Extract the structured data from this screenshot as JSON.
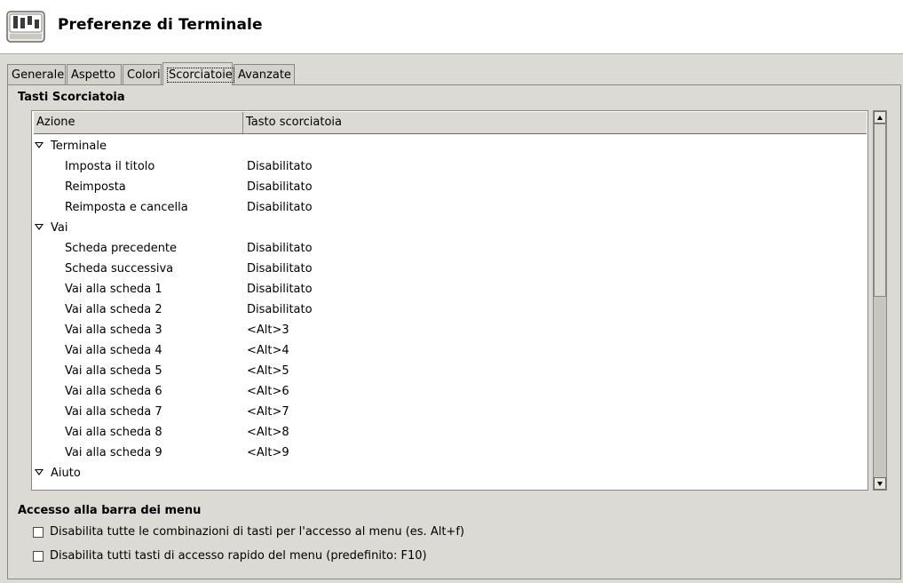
{
  "window": {
    "title": "Preferenze di Terminale"
  },
  "tabs": [
    {
      "label": "Generale",
      "active": false
    },
    {
      "label": "Aspetto",
      "active": false
    },
    {
      "label": "Colori",
      "active": false
    },
    {
      "label": "Scorciatoie",
      "active": true
    },
    {
      "label": "Avanzate",
      "active": false
    }
  ],
  "shortcuts": {
    "section_title": "Tasti Scorciatoia",
    "columns": {
      "action": "Azione",
      "shortcut": "Tasto scorciatoia"
    },
    "rows": [
      {
        "group": "Terminale"
      },
      {
        "action": "Imposta il titolo",
        "shortcut": "Disabilitato"
      },
      {
        "action": "Reimposta",
        "shortcut": "Disabilitato"
      },
      {
        "action": "Reimposta e cancella",
        "shortcut": "Disabilitato"
      },
      {
        "group": "Vai"
      },
      {
        "action": "Scheda precedente",
        "shortcut": "Disabilitato"
      },
      {
        "action": "Scheda successiva",
        "shortcut": "Disabilitato"
      },
      {
        "action": "Vai alla scheda 1",
        "shortcut": "Disabilitato"
      },
      {
        "action": "Vai alla scheda 2",
        "shortcut": "Disabilitato"
      },
      {
        "action": "Vai alla scheda 3",
        "shortcut": "<Alt>3"
      },
      {
        "action": "Vai alla scheda 4",
        "shortcut": "<Alt>4"
      },
      {
        "action": "Vai alla scheda 5",
        "shortcut": "<Alt>5"
      },
      {
        "action": "Vai alla scheda 6",
        "shortcut": "<Alt>6"
      },
      {
        "action": "Vai alla scheda 7",
        "shortcut": "<Alt>7"
      },
      {
        "action": "Vai alla scheda 8",
        "shortcut": "<Alt>8"
      },
      {
        "action": "Vai alla scheda 9",
        "shortcut": "<Alt>9"
      },
      {
        "group": "Aiuto"
      }
    ]
  },
  "menubar_access": {
    "section_title": "Accesso alla barra dei menu",
    "options": [
      {
        "label": "Disabilita tutte le combinazioni di tasti per l'accesso al menu (es. Alt+f)",
        "checked": false
      },
      {
        "label": "Disabilita tutti tasti di accesso rapido del menu (predefinito: F10)",
        "checked": false
      }
    ]
  }
}
